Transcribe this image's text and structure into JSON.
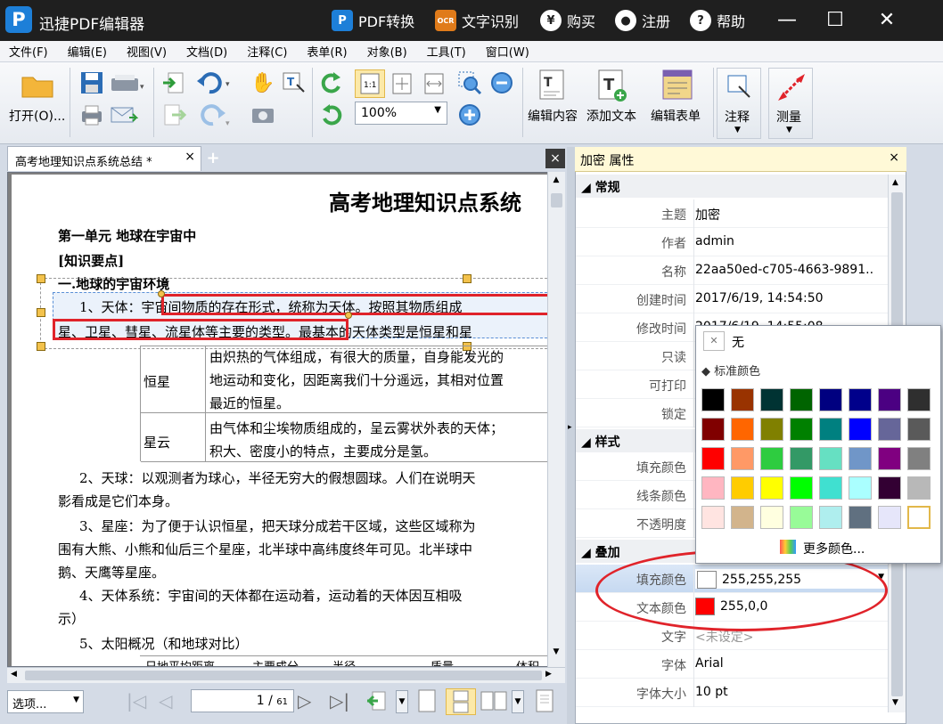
{
  "app": {
    "title": "迅捷PDF编辑器",
    "logo": "P",
    "pdf_convert": "PDF转换",
    "ocr": "文字识别",
    "ocr_badge": "OCR",
    "buy": "购买",
    "register": "注册",
    "help": "帮助"
  },
  "menu": [
    "文件(F)",
    "编辑(E)",
    "视图(V)",
    "文档(D)",
    "注释(C)",
    "表单(R)",
    "对象(B)",
    "工具(T)",
    "窗口(W)"
  ],
  "toolbar": {
    "open": "打开(O)...",
    "zoom": "100%",
    "edit_content": "编辑内容",
    "add_text": "添加文本",
    "edit_form": "编辑表单",
    "annotate": "注释",
    "measure": "测量"
  },
  "tab": {
    "title": "高考地理知识点系统总结 *",
    "close": "×",
    "add": "+",
    "close_all": "×"
  },
  "document": {
    "title": "高考地理知识点系统",
    "unit": "第一单元  地球在宇宙中",
    "points": "[知识要点]",
    "section": "一.地球的宇宙环境",
    "p1a": "1、天体：宇宙间物质的存在形式，统称为天体。按照其物质组成",
    "p1b": "星、卫星、彗星、流星体等主要的类型。最基本的天体类型是恒星和星",
    "t_star": "恒星",
    "t_star1": "由炽热的气体组成，有很大的质量，自身能发光的",
    "t_star2": "地运动和变化，因距离我们十分遥远，其相对位置",
    "t_star3": "最近的恒星。",
    "t_neb": "星云",
    "t_neb1": "由气体和尘埃物质组成的，呈云雾状外表的天体；",
    "t_neb2": "积大、密度小的特点，主要成分是氢。",
    "p2a": "2、天球：以观测者为球心，半径无穷大的假想圆球。人们在说明天",
    "p2b": "影看成是它们本身。",
    "p3a": "3、星座：为了便于认识恒星，把天球分成若干区域，这些区域称为",
    "p3b": "围有大熊、小熊和仙后三个星座，北半球中高纬度终年可见。北半球中",
    "p3c": "鹅、天鹰等星座。",
    "p4a": "4、天体系统：宇宙间的天体都在运动着，运动着的天体因互相吸",
    "p4b": "示）",
    "p5": "5、太阳概况（和地球对比）",
    "t2a": "日地平均距离",
    "t2b": "主要成分",
    "t2c": "半径",
    "t2d": "质量",
    "t2e": "体积"
  },
  "nav": {
    "options": "选项...",
    "page": "1",
    "total": "61"
  },
  "props": {
    "header": "加密 属性",
    "close": "×",
    "general": "常规",
    "rows": [
      {
        "label": "主题",
        "value": "加密"
      },
      {
        "label": "作者",
        "value": "admin"
      },
      {
        "label": "名称",
        "value": "22aa50ed-c705-4663-9891.."
      },
      {
        "label": "创建时间",
        "value": "2017/6/19, 14:54:50"
      },
      {
        "label": "修改时间",
        "value": "2017/6/19, 14:55:08"
      },
      {
        "label": "只读",
        "value": ""
      },
      {
        "label": "可打印",
        "value": ""
      },
      {
        "label": "锁定",
        "value": ""
      }
    ],
    "style": "样式",
    "style_rows": [
      {
        "label": "填充颜色"
      },
      {
        "label": "线条颜色"
      },
      {
        "label": "不透明度"
      }
    ],
    "overlay": "叠加",
    "fill_label": "填充颜色",
    "fill_value": "255,255,255",
    "fill_color": "#ffffff",
    "text_color_label": "文本颜色",
    "text_color_value": "255,0,0",
    "text_color": "#ff0000",
    "text_label": "文字",
    "text_value": "<未设定>",
    "font_label": "字体",
    "font_value": "Arial",
    "size_label": "字体大小",
    "size_value": "10 pt"
  },
  "colorpicker": {
    "none": "无",
    "standard": "标准颜色",
    "more": "更多颜色...",
    "colors": [
      [
        "#000000",
        "#993300",
        "#003333",
        "#006400",
        "#000080",
        "#00008b",
        "#4b0082",
        "#2f2f2f"
      ],
      [
        "#800000",
        "#ff6600",
        "#808000",
        "#008000",
        "#008080",
        "#0000ff",
        "#666699",
        "#5a5a5a"
      ],
      [
        "#ff0000",
        "#ff9966",
        "#2ecc40",
        "#339966",
        "#66e0c2",
        "#7096c8",
        "#800080",
        "#808080"
      ],
      [
        "#ffb6c1",
        "#ffcc00",
        "#ffff00",
        "#00ff00",
        "#40e0d0",
        "#aaffff",
        "#330033",
        "#b8b8b8"
      ],
      [
        "#ffe4e1",
        "#d2b48c",
        "#ffffe0",
        "#98fb98",
        "#afeeee",
        "#607080",
        "#e6e6fa",
        "#ffffff"
      ]
    ]
  }
}
